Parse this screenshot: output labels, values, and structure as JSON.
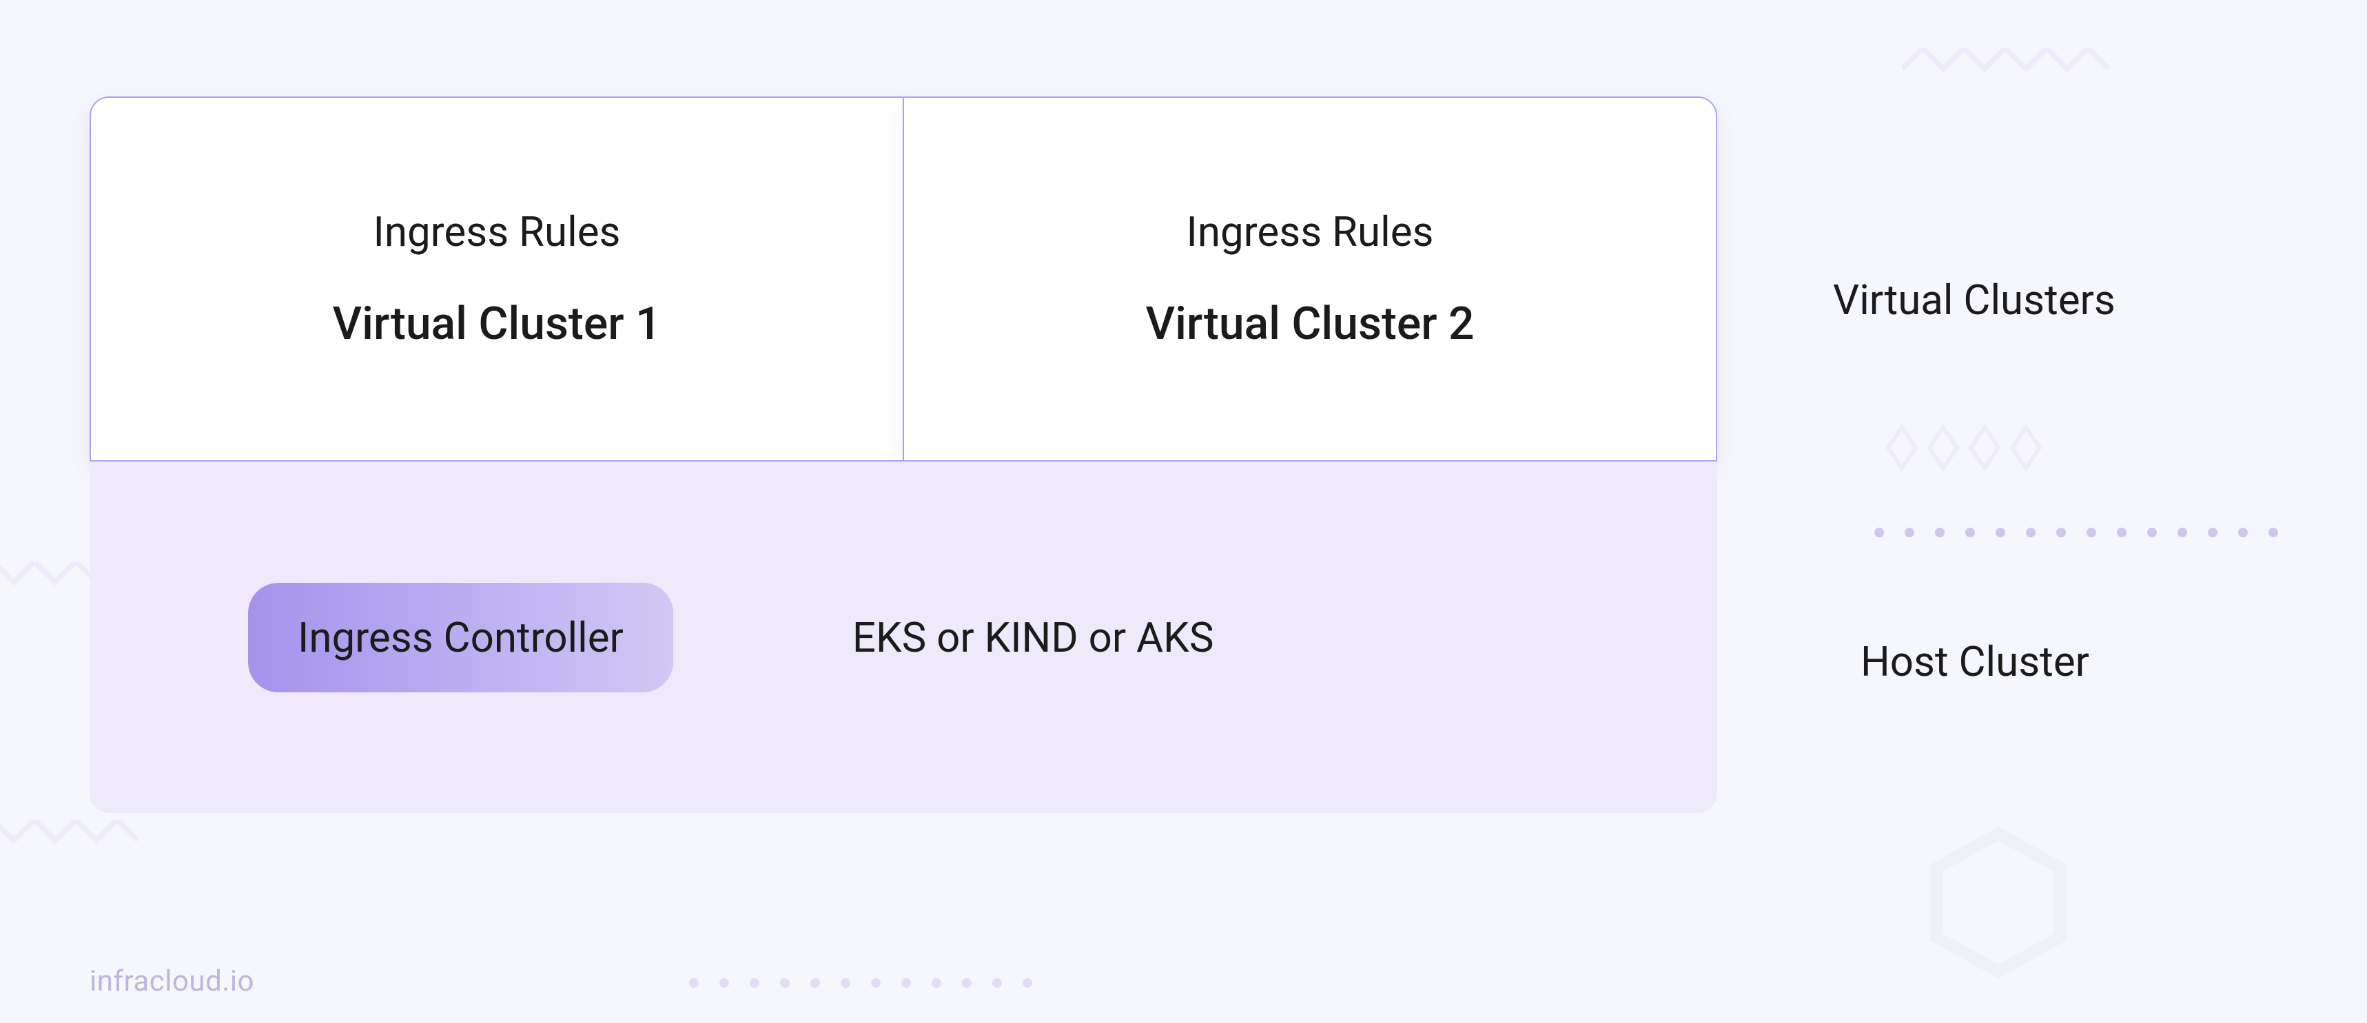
{
  "virtual_clusters": {
    "ingress_label": "Ingress Rules",
    "boxes": [
      {
        "name": "Virtual Cluster 1"
      },
      {
        "name": "Virtual Cluster 2"
      }
    ],
    "side_label": "Virtual Clusters"
  },
  "host_cluster": {
    "ingress_controller_label": "Ingress Controller",
    "providers_label": "EKS or KIND or AKS",
    "side_label": "Host Cluster"
  },
  "attribution": "infracloud.io"
}
